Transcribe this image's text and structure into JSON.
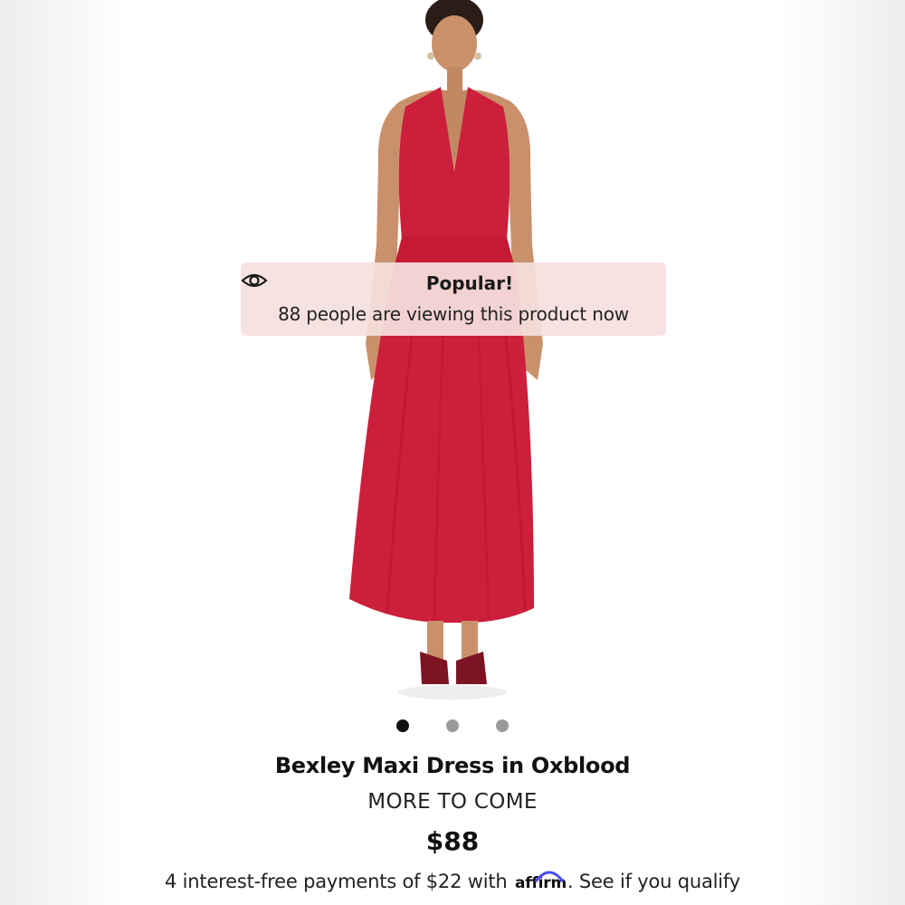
{
  "banner": {
    "title": "Popular!",
    "icon": "eye-icon",
    "message": "88 people are viewing this product now"
  },
  "carousel": {
    "total": 3,
    "active_index": 1
  },
  "product": {
    "title": "Bexley Maxi Dress in Oxblood",
    "brand": "MORE TO COME",
    "price": "$88",
    "dress_color": "#cc1f3c"
  },
  "payment": {
    "prefix": "4 interest-free payments of $22 with",
    "provider": "affirm",
    "suffix": ". See if you qualify",
    "accent_color": "#4a4af4"
  },
  "colors": {
    "banner_background": "#f5e0de",
    "active_dot": "#111111",
    "inactive_dot": "#9a9a9a"
  }
}
